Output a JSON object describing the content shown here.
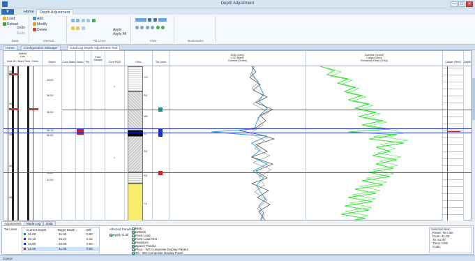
{
  "window": {
    "title": "Depth Adjustment",
    "min_label": "—",
    "max_label": "□",
    "close_label": "✕"
  },
  "ribbon_tabs": [
    {
      "label": "Home"
    },
    {
      "label": "Depth Adjustment"
    }
  ],
  "file_menu": {
    "label": "▼"
  },
  "ribbon": {
    "groups": [
      {
        "label": "Data",
        "items": [
          "Load",
          "Reload",
          "Undo",
          "Redo"
        ]
      },
      {
        "label": "Interval",
        "items": [
          "Add",
          "Modify",
          "Delete"
        ]
      },
      {
        "label": "Tie Lines",
        "items": [
          "Apply",
          "Apply All"
        ]
      },
      {
        "label": "View",
        "items": []
      },
      {
        "label": "Bookmarks",
        "items": []
      }
    ]
  },
  "doc_tabs": [
    {
      "label": "Home"
    },
    {
      "label": "Configuration Manager"
    },
    {
      "label": "Coal Log Depth Adjustment Tool"
    }
  ],
  "track_headers": [
    {
      "label": "Hole ID / Start Time / Horiz"
    },
    {
      "label": "Depth"
    },
    {
      "label": "Core State"
    },
    {
      "label": "Seam"
    },
    {
      "label": "Ply"
    },
    {
      "label": "Sample"
    },
    {
      "label": "Core RQD"
    },
    {
      "label": "Litho"
    },
    {
      "label": "Tie Lines"
    },
    {
      "label": "SSD (Grey)\nLSD (Blue)\nGamma (Green)"
    },
    {
      "label": "Gamma (Green)\nCaliper (Red)\nResistivity Deep (Grey)"
    },
    {
      "label": "Caliper (Red)"
    },
    {
      "label": "Depth"
    }
  ],
  "header_top_labels": {
    "a": "Airfield",
    "b": "Line",
    "c": "Face"
  },
  "depth_ticks": [
    "25",
    "30",
    "35",
    "40",
    "45"
  ],
  "depth_labels": [
    "25.00",
    "30.00",
    "35.00",
    "36.12",
    "36.62",
    "41.60",
    "42.00"
  ],
  "litho_labels": [
    "CO",
    "SS",
    "MS",
    "ST",
    "SS",
    "SS",
    "CL"
  ],
  "bottom_tabs": [
    {
      "label": "Adjustments"
    },
    {
      "label": "Mode Log"
    },
    {
      "label": "Data"
    }
  ],
  "tie_lines": {
    "section_label": "Tie Lines",
    "columns": [
      "Current Depth",
      "Target Depth",
      "Diff"
    ],
    "rows": [
      {
        "current": "31.00",
        "target": "31.00",
        "diff": "0.00"
      },
      {
        "current": "34.12",
        "target": "34.24",
        "diff": "0.12"
      },
      {
        "current": "34.90",
        "target": "34.90",
        "diff": "0.00"
      },
      {
        "current": "41.00",
        "target": "41.00",
        "diff": "0.00"
      }
    ]
  },
  "affected_panels": {
    "label": "Affected Panels",
    "apply_all": "Apply to all",
    "items": [
      "RMU",
      "Defects",
      "Point Load",
      "Point Load Test",
      "Resistors",
      "Spacer Panel4",
      "Phoo - WS Composite Display Panel1",
      "TS - WS Composite Display Panel"
    ]
  },
  "selected_item": {
    "label": "Selected Item",
    "lines": [
      "Panel: Tie Line",
      "From: 41.00",
      "To: 41.00",
      "Thick: 0.00",
      "Code:"
    ]
  },
  "status": {
    "text": "Cursor:"
  },
  "colors": {
    "accent": "#2f6db5",
    "ssd": "#555555",
    "lsd": "#2aa7d8",
    "gamma": "#2ee52e",
    "caliper": "#dd2222",
    "tie_teal": "#1a8a8a",
    "tie_blue": "#1f2fd8",
    "tie_red": "#e02020"
  }
}
